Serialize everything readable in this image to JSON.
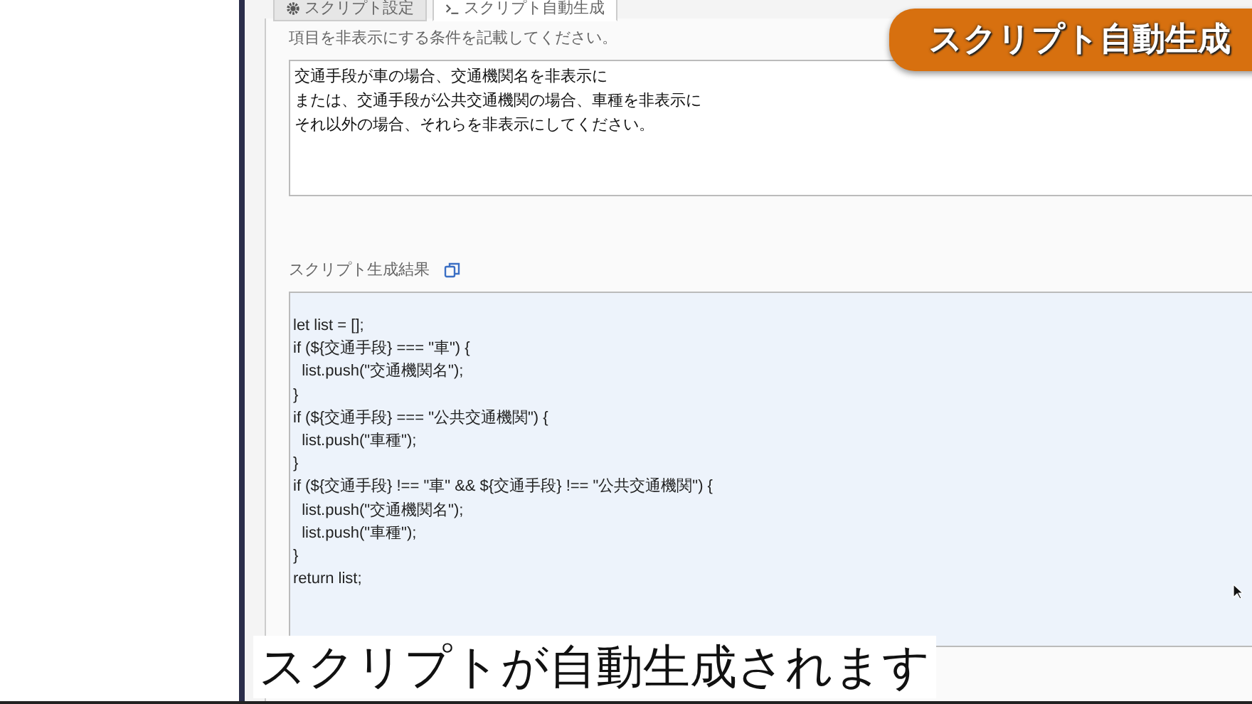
{
  "tabs": [
    {
      "label": "スクリプト設定",
      "selected": false
    },
    {
      "label": "スクリプト自動生成",
      "selected": true
    }
  ],
  "banner": "スクリプト自動生成",
  "condition": {
    "label": "項目を非表示にする条件を記載してください。",
    "lines": [
      "交通手段が車の場合、交通機関名を非表示に",
      "または、交通手段が公共交通機関の場合、車種を非表示に",
      "それ以外の場合、それらを非表示にしてください。"
    ]
  },
  "result": {
    "label": "スクリプト生成結果",
    "code": [
      "let list = [];",
      "if (${交通手段} === \"車\") {",
      "  list.push(\"交通機関名\");",
      "}",
      "if (${交通手段} === \"公共交通機関\") {",
      "  list.push(\"車種\");",
      "}",
      "if (${交通手段} !== \"車\" && ${交通手段} !== \"公共交通機関\") {",
      "  list.push(\"交通機関名\");",
      "  list.push(\"車種\");",
      "}",
      "return list;"
    ]
  },
  "caption": "スクリプトが自動生成されます"
}
